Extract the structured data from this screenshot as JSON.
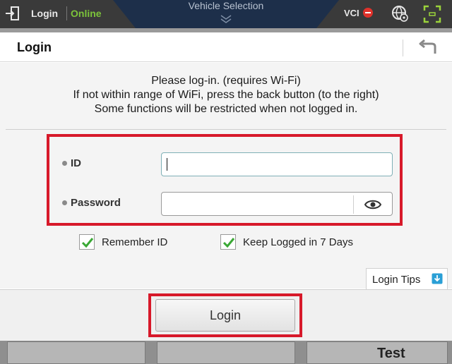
{
  "topbar": {
    "login_label": "Login",
    "status": "Online",
    "center_title": "Vehicle Selection",
    "vci_label": "VCI",
    "icons": [
      "logout-icon",
      "chevron-down-icon",
      "vci-disconnected-icon",
      "globe-settings-icon",
      "fullscreen-icon"
    ]
  },
  "background": {
    "visible_text": "Test"
  },
  "dialog": {
    "title": "Login",
    "message": {
      "line1": "Please log-in. (requires Wi-Fi)",
      "line2": "If not within range of WiFi, press the back button (to the right)",
      "line3": "Some functions will be restricted when not logged in."
    },
    "id_label": "ID",
    "id_value": "",
    "password_label": "Password",
    "password_value": "",
    "remember_id": {
      "label": "Remember ID",
      "checked": true
    },
    "keep_logged": {
      "label": "Keep Logged in 7 Days",
      "checked": true
    },
    "tips_label": "Login Tips",
    "login_button": "Login"
  },
  "colors": {
    "highlight": "#d7192a",
    "online": "#7cc43a",
    "check": "#3aa835",
    "accent": "#2a9fd6"
  }
}
